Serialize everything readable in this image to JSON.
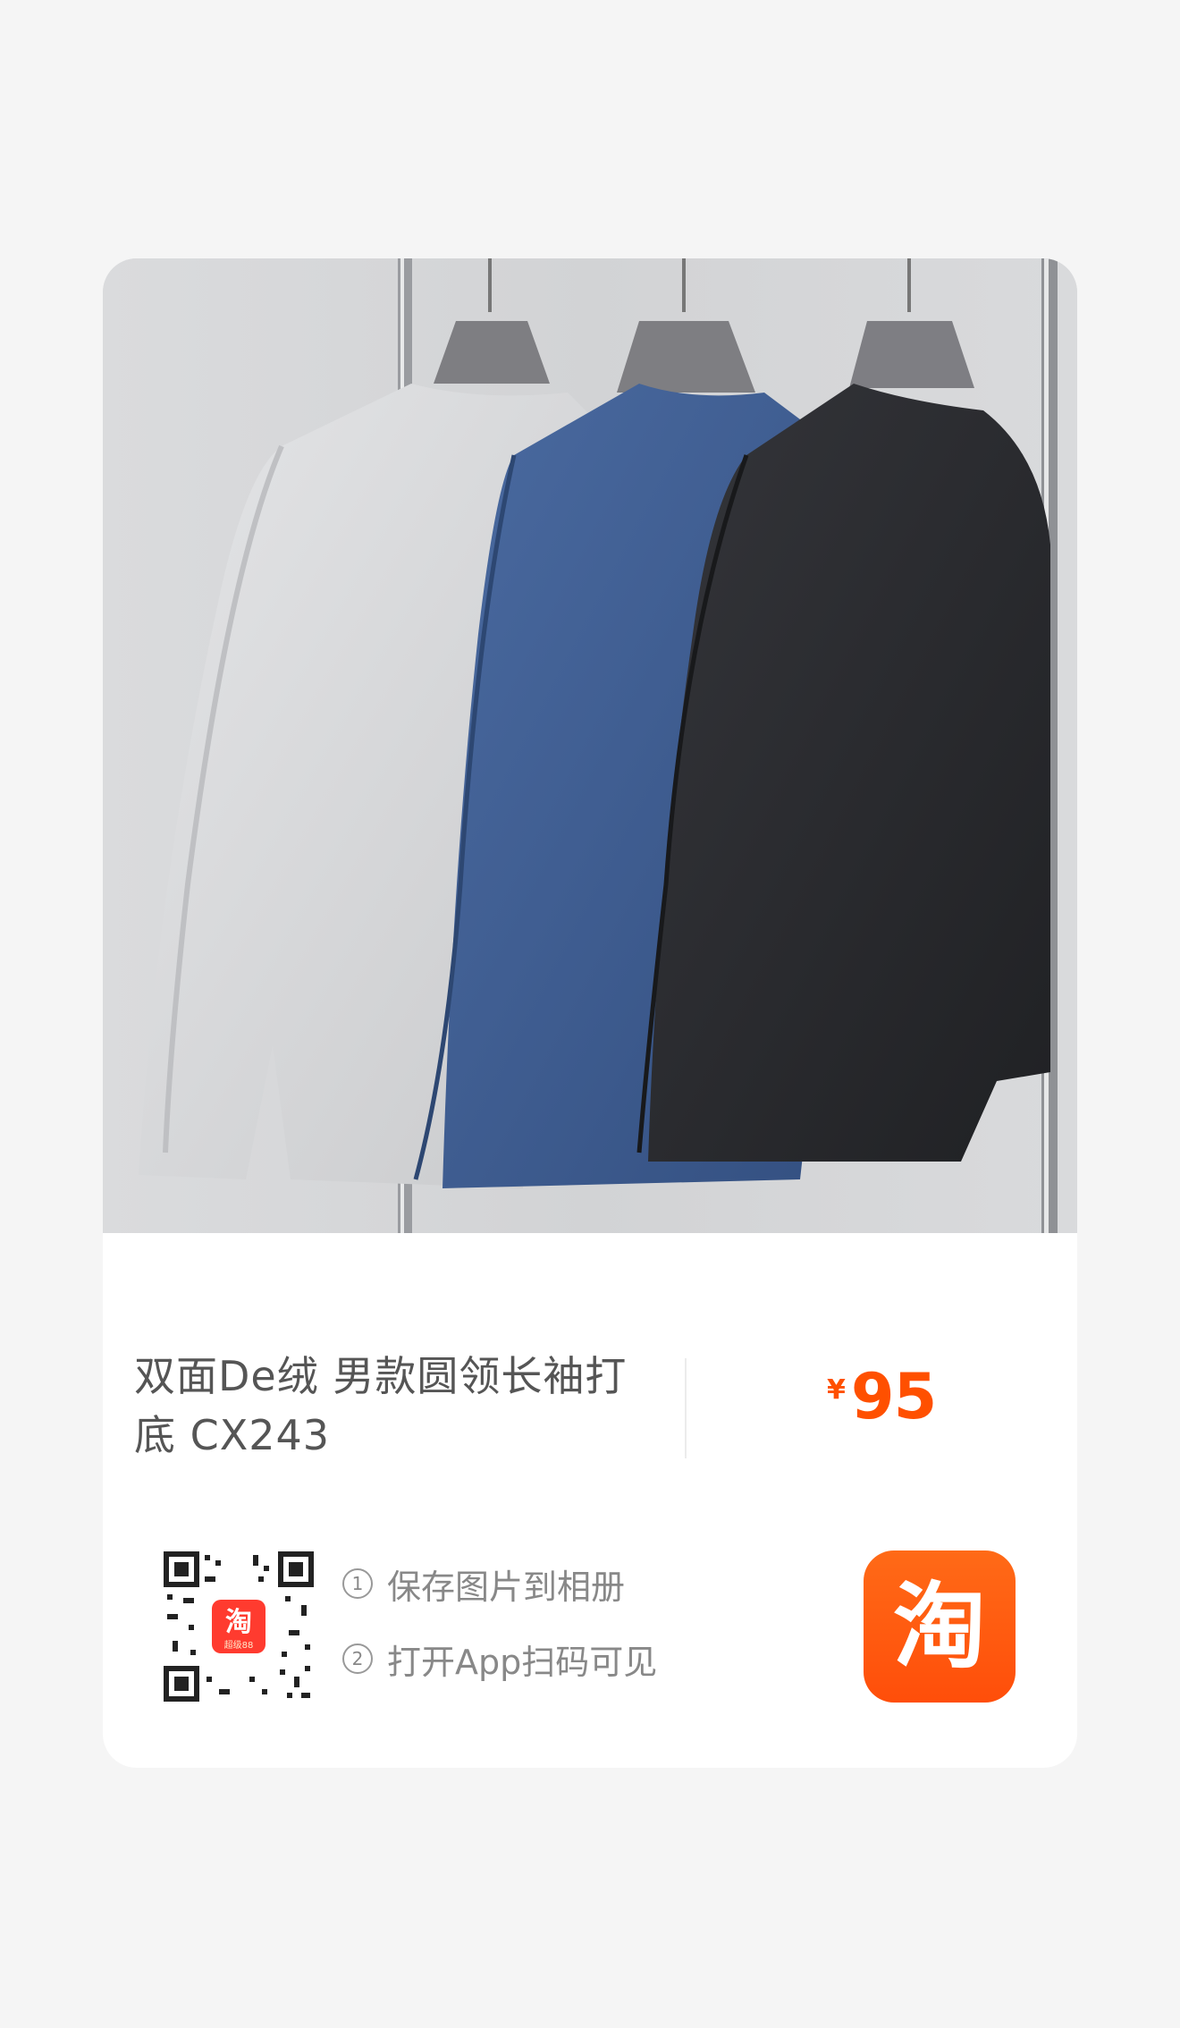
{
  "product": {
    "title_line1": "双面De绒 男款圆领长袖打",
    "title_line2": "底 CX243",
    "currency": "¥",
    "price": "95"
  },
  "share": {
    "step1_number": "1",
    "step1_text": "保存图片到相册",
    "step2_number": "2",
    "step2_text": "打开App扫码可见"
  },
  "qr": {
    "center_logo_char": "淘",
    "center_logo_caption": "超级88"
  },
  "app": {
    "icon_char": "淘"
  },
  "colors": {
    "accent": "#ff5000",
    "app_icon": "#ff5a10",
    "shirt_light": "#d8d9db",
    "shirt_blue": "#3f5f94",
    "shirt_black": "#2c2d30"
  }
}
